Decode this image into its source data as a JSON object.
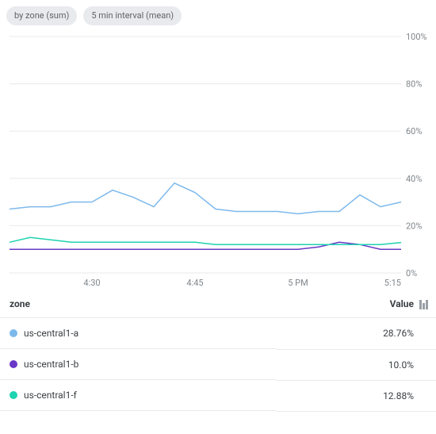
{
  "chips": [
    {
      "label": "by zone (sum)"
    },
    {
      "label": "5 min interval (mean)"
    }
  ],
  "colors": {
    "us-central1-a": "#7eb9ec",
    "us-central1-b": "#6a38c7",
    "us-central1-f": "#1dd3b0"
  },
  "table": {
    "columns": {
      "zone": "zone",
      "value": "Value"
    },
    "rows": [
      {
        "color_key": "us-central1-a",
        "zone": "us-central1-a",
        "value": "28.76%"
      },
      {
        "color_key": "us-central1-b",
        "zone": "us-central1-b",
        "value": "10.0%"
      },
      {
        "color_key": "us-central1-f",
        "zone": "us-central1-f",
        "value": "12.88%"
      }
    ]
  },
  "chart_data": {
    "type": "line",
    "title": "",
    "xlabel": "",
    "ylabel": "",
    "ylim": [
      0,
      100
    ],
    "y_unit": "%",
    "y_ticks": [
      0,
      20,
      40,
      60,
      80,
      100
    ],
    "x_tick_labels": [
      "4:30",
      "4:45",
      "5 PM",
      "5:15"
    ],
    "x_tick_positions": [
      4,
      9,
      14,
      19
    ],
    "x": [
      0,
      1,
      2,
      3,
      4,
      5,
      6,
      7,
      8,
      9,
      10,
      11,
      12,
      13,
      14,
      15,
      16,
      17,
      18,
      19
    ],
    "series": [
      {
        "name": "us-central1-a",
        "color_key": "us-central1-a",
        "values": [
          27,
          28,
          28,
          30,
          30,
          35,
          32,
          28,
          38,
          34,
          27,
          26,
          26,
          26,
          25,
          26,
          26,
          33,
          28,
          30
        ]
      },
      {
        "name": "us-central1-b",
        "color_key": "us-central1-b",
        "values": [
          10,
          10,
          10,
          10,
          10,
          10,
          10,
          10,
          10,
          10,
          10,
          10,
          10,
          10,
          10,
          11,
          13,
          12,
          10,
          10
        ]
      },
      {
        "name": "us-central1-f",
        "color_key": "us-central1-f",
        "values": [
          13,
          15,
          14,
          13,
          13,
          13,
          13,
          13,
          13,
          13,
          12,
          12,
          12,
          12,
          12,
          12,
          12,
          12,
          12,
          12.88
        ]
      }
    ]
  }
}
